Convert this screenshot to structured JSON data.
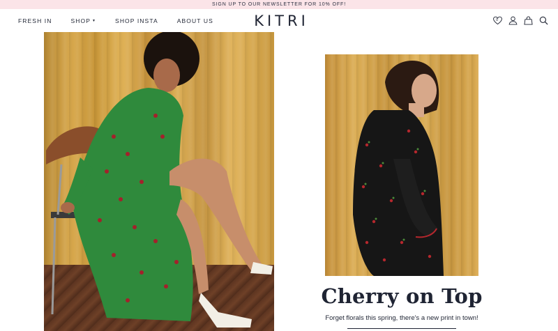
{
  "promo_bar": {
    "text": "SIGN UP TO OUR NEWSLETTER FOR 10% OFF!"
  },
  "header": {
    "nav": [
      {
        "label": "FRESH IN"
      },
      {
        "label": "SHOP",
        "has_dropdown": true
      },
      {
        "label": "SHOP INSTA"
      },
      {
        "label": "ABOUT US"
      }
    ],
    "logo": "KITRI",
    "wishlist_count": "0",
    "icons": [
      "heart-icon",
      "account-icon",
      "bag-icon",
      "search-icon"
    ]
  },
  "colors": {
    "promo_bg": "#fbe4e8",
    "text": "#1f2433",
    "curtain": "#d8a84c"
  },
  "feature": {
    "title": "Cherry on Top",
    "subtitle": "Forget florals this spring, there's a new print in town!"
  }
}
